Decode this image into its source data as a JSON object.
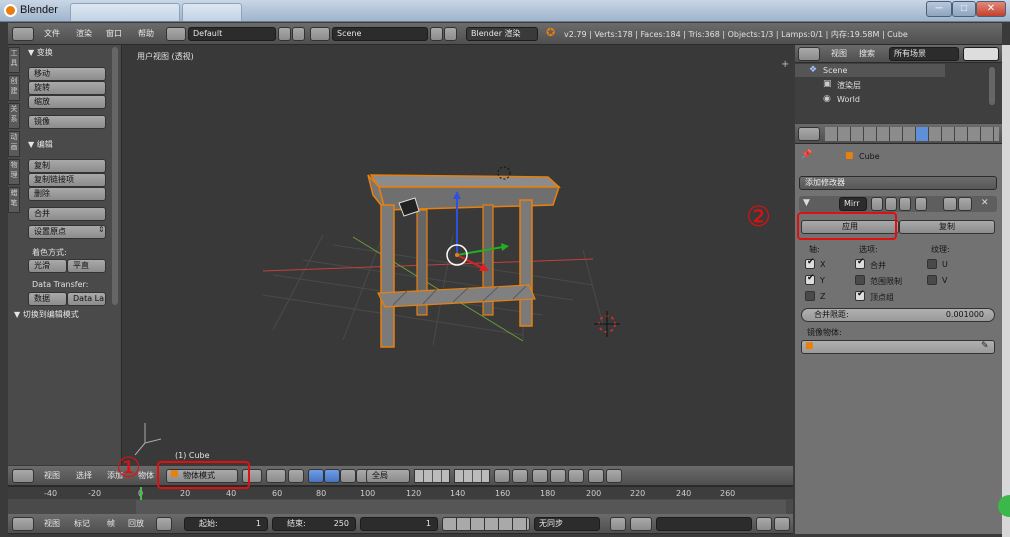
{
  "window": {
    "title": "Blender",
    "buttons": [
      "─",
      "□",
      "✕"
    ]
  },
  "info_bar": {
    "menus": [
      "文件",
      "渲染",
      "窗口",
      "帮助"
    ],
    "layout": "Default",
    "scene": "Scene",
    "engine": "Blender 渲染",
    "stats": "v2.79 | Verts:178 | Faces:184 | Tris:368 | Objects:1/3 | Lamps:0/1 | 内存:19.58M | Cube"
  },
  "tool_shelf": {
    "tabs": [
      "工具",
      "创建",
      "关系",
      "动画",
      "物理",
      "蜡笔"
    ],
    "transform_header": "▼ 变换",
    "transform_buttons": [
      "移动",
      "旋转",
      "缩放"
    ],
    "mirror_button": "镜像",
    "edit_header": "▼ 编辑",
    "edit_buttons": [
      "复制",
      "复制链接项",
      "删除"
    ],
    "join_button": "合并",
    "set_origin": "设置原点",
    "shading_label": "着色方式:",
    "shading_smooth": "光滑",
    "shading_flat": "平直",
    "data_transfer_label": "Data Transfer:",
    "data_button": "数据",
    "data_layers_button": "Data La",
    "toggle_editmode": "▼ 切换到编辑模式"
  },
  "viewport": {
    "title": "用户视图 (透视)",
    "object_label": "(1) Cube",
    "header_menus": [
      "视图",
      "选择",
      "添加",
      "物体"
    ],
    "mode": "物体模式",
    "pivot": "全局"
  },
  "outliner": {
    "menus": [
      "视图",
      "搜索"
    ],
    "filter": "所有场景",
    "items": [
      "Scene",
      "渲染层",
      "World"
    ]
  },
  "properties": {
    "object_name": "Cube",
    "add_modifier": "添加修改器",
    "modifier_name": "Mirr",
    "apply_button": "应用",
    "copy_button": "复制",
    "axis_label": "轴:",
    "options_label": "选项:",
    "texture_label": "纹理:",
    "axes": [
      {
        "label": "X",
        "checked": true
      },
      {
        "label": "Y",
        "checked": true
      },
      {
        "label": "Z",
        "checked": false
      }
    ],
    "options": [
      {
        "label": "合并",
        "checked": true
      },
      {
        "label": "范围限制",
        "checked": false
      },
      {
        "label": "顶点组",
        "checked": true
      }
    ],
    "textures": [
      {
        "label": "U",
        "checked": false
      },
      {
        "label": "V",
        "checked": false
      }
    ],
    "merge_limit_label": "合并限距:",
    "merge_limit_value": "0.001000",
    "mirror_object_label": "镜像物体:"
  },
  "timeline": {
    "ruler": [
      "-40",
      "-20",
      "0",
      "20",
      "40",
      "60",
      "80",
      "100",
      "120",
      "140",
      "160",
      "180",
      "200",
      "220",
      "240",
      "260"
    ],
    "menus": [
      "视图",
      "标记",
      "帧",
      "回放"
    ],
    "start_label": "起始:",
    "start_value": "1",
    "end_label": "结束:",
    "end_value": "250",
    "current_frame": "1",
    "sync": "无同步"
  },
  "annotations": {
    "one": "①",
    "two": "②"
  },
  "colors": {
    "accent_orange": "#e8800d",
    "annotation_red": "#e01010",
    "viewport_bg": "#393939"
  }
}
